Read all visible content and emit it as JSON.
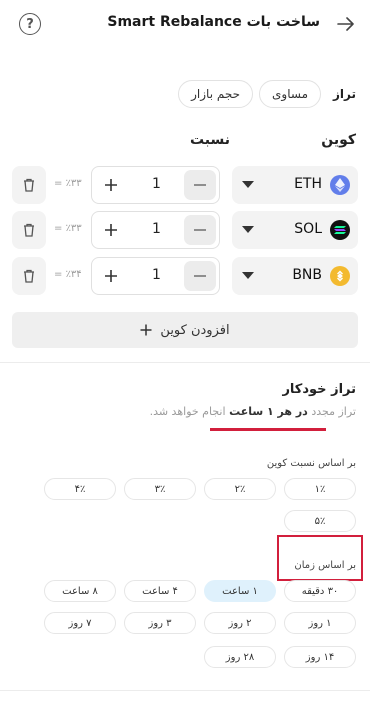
{
  "header": {
    "title": "ساخت بات Smart Rebalance",
    "help_icon": "question-circle-icon",
    "back_icon": "arrow-right-icon"
  },
  "balance": {
    "label": "تراز",
    "options": [
      "مساوی",
      "حجم بازار"
    ]
  },
  "columns": {
    "coin": "کوین",
    "ratio": "نسبت"
  },
  "coins": [
    {
      "symbol": "ETH",
      "icon": "ethereum-icon",
      "color": "#627eea",
      "value": "1",
      "percent": "٪۳۳ ="
    },
    {
      "symbol": "SOL",
      "icon": "solana-icon",
      "color": "#9945ff",
      "value": "1",
      "percent": "٪۳۳ ="
    },
    {
      "symbol": "BNB",
      "icon": "bnb-icon",
      "color": "#f3ba2f",
      "value": "1",
      "percent": "٪۳۴ ="
    }
  ],
  "add_coin": {
    "label": "افزودن کوین"
  },
  "auto_balance": {
    "title": "تراز خودکار",
    "desc_prefix": "تراز مجدد",
    "desc_bold": "در هر ۱ ساعت",
    "desc_suffix": "انجام خواهد شد."
  },
  "ratio_based": {
    "label": "بر اساس نسبت کوین",
    "options": [
      "۱٪",
      "۲٪",
      "۳٪",
      "۴٪",
      "۵٪"
    ]
  },
  "time_based": {
    "label": "بر اساس زمان",
    "selected": "۱ ساعت",
    "options": [
      "۳۰ دقیقه",
      "۱ ساعت",
      "۴ ساعت",
      "۸ ساعت",
      "۱ روز",
      "۲ روز",
      "۳ روز",
      "۷ روز",
      "۱۴ روز",
      "۲۸ روز"
    ]
  },
  "colors": {
    "highlight": "#d21f3c",
    "selected_chip": "#dff1fc"
  }
}
